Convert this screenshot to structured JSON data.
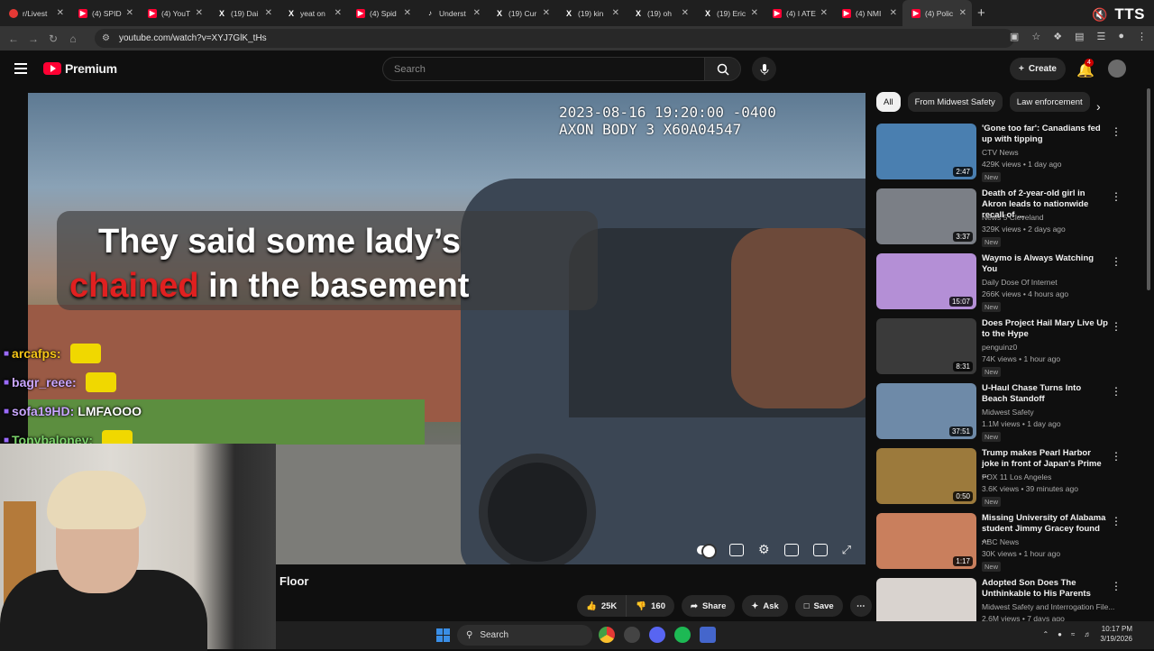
{
  "browser": {
    "tabs": [
      {
        "label": "r/Livest",
        "icon": "reddit-icon"
      },
      {
        "label": "(4) SPID",
        "icon": "youtube-icon"
      },
      {
        "label": "(4) YouT",
        "icon": "youtube-icon"
      },
      {
        "label": "(19) Dai",
        "icon": "x-icon"
      },
      {
        "label": "yeat on",
        "icon": "x-icon"
      },
      {
        "label": "(4) Spid",
        "icon": "youtube-icon"
      },
      {
        "label": "Underst",
        "icon": "tiktok-icon"
      },
      {
        "label": "(19) Cur",
        "icon": "x-icon"
      },
      {
        "label": "(19) kin",
        "icon": "x-icon"
      },
      {
        "label": "(19) oh",
        "icon": "x-icon"
      },
      {
        "label": "(19) Eric",
        "icon": "x-icon"
      },
      {
        "label": "(4) I ATE",
        "icon": "youtube-icon"
      },
      {
        "label": "(4) NMI",
        "icon": "youtube-icon"
      },
      {
        "label": "(4) Polic",
        "icon": "youtube-icon",
        "active": true
      }
    ],
    "new_tab": "+",
    "overlay_brand": "TTS",
    "url": "youtube.com/watch?v=XYJ7GlK_tHs"
  },
  "youtube": {
    "logo_text": "Premium",
    "search_placeholder": "Search",
    "create_label": "Create",
    "notification_count": "4"
  },
  "video": {
    "timestamp_line1": "2023-08-16 19:20:00 -0400",
    "timestamp_line2": "AXON BODY 3 X60A04547",
    "caption_line1": "They said some lady’s",
    "caption_highlight": "chained",
    "caption_line2_rest": " in the basement",
    "title": "Floor",
    "likes": "25K",
    "dislikes": "160",
    "share_label": "Share",
    "ask_label": "Ask",
    "save_label": "Save"
  },
  "chat": [
    {
      "user": "arcafps:",
      "color": "#f5c518",
      "msg": "",
      "emote": true
    },
    {
      "user": "bagr_reee:",
      "color": "#c9a6ff",
      "msg": "",
      "emote": true
    },
    {
      "user": "sofa19HD:",
      "color": "#c9a6ff",
      "msg": "LMFAOOO",
      "emote": false
    },
    {
      "user": "Tonybaloney:",
      "color": "#7bd36a",
      "msg": "",
      "emote": true
    }
  ],
  "chips": [
    "All",
    "From Midwest Safety",
    "Law enforcement"
  ],
  "recommendations": [
    {
      "title": "'Gone too far': Canadians fed up with tipping",
      "channel": "CTV News",
      "meta": "429K views • 1 day ago",
      "badge": "New",
      "duration": "2:47",
      "thumb": "#4a7fb0"
    },
    {
      "title": "Death of 2-year-old girl in Akron leads to nationwide recall of ...",
      "channel": "News 5 Cleveland",
      "meta": "329K views • 2 days ago",
      "badge": "New",
      "duration": "3:37",
      "thumb": "#7b7f86"
    },
    {
      "title": "Waymo is Always Watching You",
      "channel": "Daily Dose Of Internet",
      "meta": "266K views • 4 hours ago",
      "badge": "New",
      "duration": "15:07",
      "thumb": "#b48fd6"
    },
    {
      "title": "Does Project Hail Mary Live Up to the Hype",
      "channel": "penguinz0",
      "meta": "74K views • 1 hour ago",
      "badge": "New",
      "duration": "8:31",
      "thumb": "#3a3a3a"
    },
    {
      "title": "U-Haul Chase Turns Into Beach Standoff",
      "channel": "Midwest Safety",
      "meta": "1.1M views • 1 day ago",
      "badge": "New",
      "duration": "37:51",
      "thumb": "#6e8aa8"
    },
    {
      "title": "Trump makes Pearl Harbor joke in front of Japan's Prime ...",
      "channel": "FOX 11 Los Angeles",
      "meta": "3.6K views • 39 minutes ago",
      "badge": "New",
      "duration": "0:50",
      "thumb": "#9c7a3c"
    },
    {
      "title": "Missing University of Alabama student Jimmy Gracey found ...",
      "channel": "ABC News",
      "meta": "30K views • 1 hour ago",
      "badge": "New",
      "duration": "1:17",
      "thumb": "#c97f5d"
    },
    {
      "title": "Adopted Son Does The Unthinkable to His Parents",
      "channel": "Midwest Safety and Interrogation File...",
      "meta": "2.6M views • 7 days ago",
      "badge": "",
      "duration": "",
      "thumb": "#d9d3cf"
    }
  ],
  "taskbar": {
    "search_label": "Search",
    "time": "10:17 PM",
    "date": "3/19/2026"
  }
}
